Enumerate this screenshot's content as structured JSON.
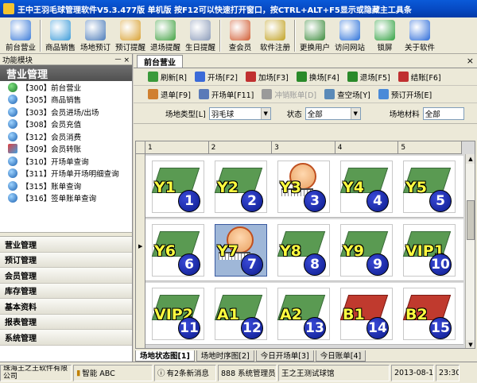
{
  "window": {
    "title": "王中王羽毛球管理软件V5.3.477版 单机版 按F12可以快速打开窗口，按CTRL+ALT+F5显示或隐藏主工具条"
  },
  "toolbar": [
    {
      "label": "前台营业",
      "icon": "notepad-icon",
      "color": "#3a7ad8"
    },
    {
      "label": "商品销售",
      "icon": "person-icon",
      "color": "#3a9ad8"
    },
    {
      "label": "场地预订",
      "icon": "calendar-icon",
      "color": "#4a7ab8"
    },
    {
      "label": "预订提醒",
      "icon": "clipboard-icon",
      "color": "#d8a030"
    },
    {
      "label": "退场提醒",
      "icon": "screen-icon",
      "color": "#40a040"
    },
    {
      "label": "生日提醒",
      "icon": "window-icon",
      "color": "#8a9ab8"
    },
    {
      "label": "查会员",
      "icon": "users-icon",
      "color": "#d05a30"
    },
    {
      "label": "软件注册",
      "icon": "key-icon",
      "color": "#c0a020"
    },
    {
      "label": "更换用户",
      "icon": "user-switch-icon",
      "color": "#3a8a3a"
    },
    {
      "label": "访问网站",
      "icon": "ie-icon",
      "color": "#2a70d8"
    },
    {
      "label": "锁屏",
      "icon": "lock-arrow-icon",
      "color": "#30a040"
    },
    {
      "label": "关于软件",
      "icon": "help-icon",
      "color": "#2a6ad8"
    }
  ],
  "left": {
    "header": "功能模块",
    "section": "营业管理",
    "items": [
      {
        "label": "【300】前台营业",
        "icon": "notepad-icon"
      },
      {
        "label": "【305】商品销售",
        "icon": "globe-icon"
      },
      {
        "label": "【303】会员进场/出场",
        "icon": "globe-icon"
      },
      {
        "label": "【308】会员充值",
        "icon": "globe-icon"
      },
      {
        "label": "【312】会员消费",
        "icon": "globe-icon"
      },
      {
        "label": "【309】会员转账",
        "icon": "multi-icon"
      },
      {
        "label": "【310】开场单查询",
        "icon": "globe-icon"
      },
      {
        "label": "【311】开场单开场明细查询",
        "icon": "globe-icon"
      },
      {
        "label": "【315】账单查询",
        "icon": "globe-icon"
      },
      {
        "label": "【316】签单账单查询",
        "icon": "globe-icon"
      }
    ],
    "menu": [
      "营业管理",
      "预订管理",
      "会员管理",
      "库存管理",
      "基本资料",
      "报表管理",
      "系统管理"
    ]
  },
  "main": {
    "tab": "前台营业",
    "close": "×",
    "row1": [
      {
        "label": "刷新[R]",
        "icon": "refresh-icon",
        "color": "#3a9a3a"
      },
      {
        "label": "开场[F2]",
        "icon": "open-venue-icon",
        "color": "#3a6ad8"
      },
      {
        "label": "加场[F3]",
        "icon": "add-venue-icon",
        "color": "#c03030"
      },
      {
        "label": "换场[F4]",
        "icon": "swap-venue-icon",
        "color": "#2a8a2a"
      },
      {
        "label": "退场[F5]",
        "icon": "exit-venue-icon",
        "color": "#2a8a2a"
      },
      {
        "label": "结账[F6]",
        "icon": "checkout-icon",
        "color": "#c03030"
      }
    ],
    "row2": [
      {
        "label": "退单[F9]",
        "icon": "refund-icon",
        "color": "#d08030",
        "disabled": false
      },
      {
        "label": "开场单[F11]",
        "icon": "receipt-icon",
        "color": "#5a7ab8",
        "disabled": false
      },
      {
        "label": "冲销账单[D]",
        "icon": "void-icon",
        "color": "#9a9a9a",
        "disabled": true
      },
      {
        "label": "查空场[Y]",
        "icon": "search-venue-icon",
        "color": "#5a8ab8",
        "disabled": false
      },
      {
        "label": "预订开场[E]",
        "icon": "reserve-open-icon",
        "color": "#4a8ad8",
        "disabled": false
      }
    ],
    "filter": {
      "type_label": "场地类型[L]",
      "type_value": "羽毛球",
      "status_label": "状态",
      "status_value": "全部",
      "material_label": "场地材料",
      "material_value": "全部"
    },
    "columns": [
      "1",
      "2",
      "3",
      "4",
      "5"
    ],
    "rows": [
      [
        {
          "name": "Y1",
          "num": "1",
          "state": "idle",
          "floor": "grass"
        },
        {
          "name": "Y2",
          "num": "2",
          "state": "idle",
          "floor": "grass"
        },
        {
          "name": "Y3",
          "num": "3",
          "state": "playing",
          "floor": "grass"
        },
        {
          "name": "Y4",
          "num": "4",
          "state": "idle",
          "floor": "grass"
        },
        {
          "name": "Y5",
          "num": "5",
          "state": "idle",
          "floor": "grass"
        }
      ],
      [
        {
          "name": "Y6",
          "num": "6",
          "state": "idle",
          "floor": "grass"
        },
        {
          "name": "Y7",
          "num": "7",
          "state": "selected",
          "floor": "grass"
        },
        {
          "name": "Y8",
          "num": "8",
          "state": "idle",
          "floor": "grass"
        },
        {
          "name": "Y9",
          "num": "9",
          "state": "idle",
          "floor": "grass"
        },
        {
          "name": "VIP1",
          "num": "10",
          "state": "idle",
          "floor": "grass"
        }
      ],
      [
        {
          "name": "VIP2",
          "num": "11",
          "state": "idle",
          "floor": "grass"
        },
        {
          "name": "A1",
          "num": "12",
          "state": "idle",
          "floor": "grass"
        },
        {
          "name": "A2",
          "num": "13",
          "state": "idle",
          "floor": "grass"
        },
        {
          "name": "B1",
          "num": "14",
          "state": "idle",
          "floor": "wood"
        },
        {
          "name": "B2",
          "num": "15",
          "state": "idle",
          "floor": "wood"
        }
      ]
    ],
    "bottom_tabs": [
      "场地状态图[1]",
      "场地时序图[2]",
      "今日开场单[3]",
      "今日账单[4]"
    ],
    "active_bottom_tab": 0
  },
  "status": {
    "company": "珠海王之王软件有限公司",
    "ime": "智能 ABC",
    "messages": "有2条新消息",
    "user": "888 系统管理员",
    "venue": "王之王测试球馆",
    "date": "2013-08-16",
    "time": "23:30"
  }
}
